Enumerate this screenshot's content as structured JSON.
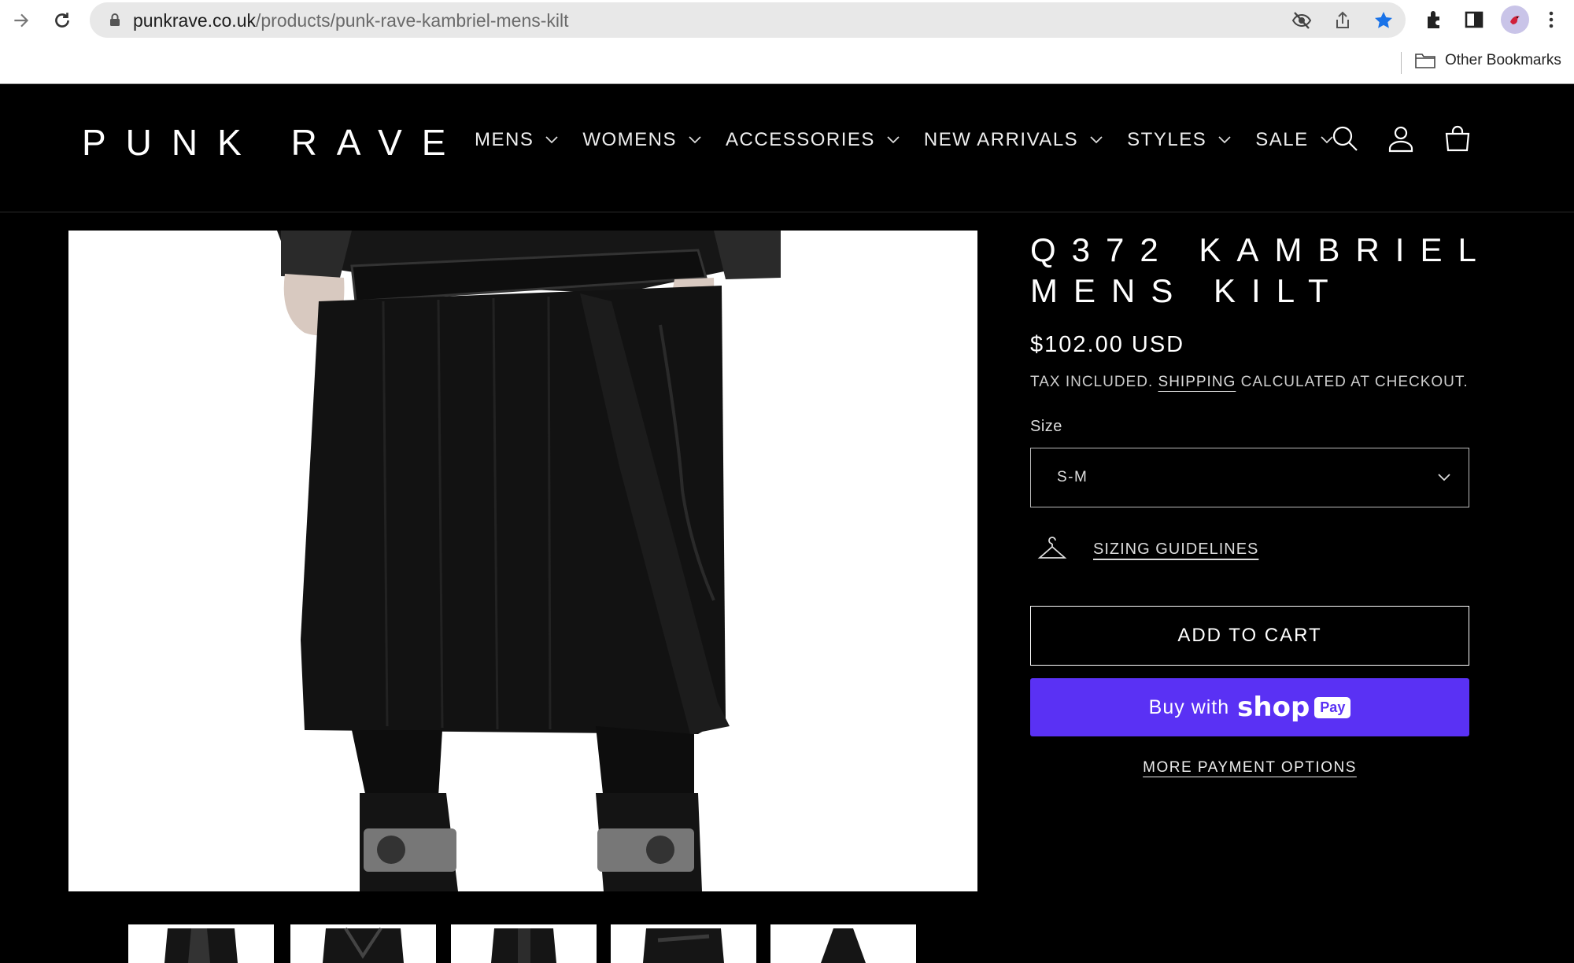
{
  "browser": {
    "url_host": "punkrave.co.uk",
    "url_path": "/products/punk-rave-kambriel-mens-kilt",
    "bookmarks_label": "Other Bookmarks",
    "star_color": "#1a73e8"
  },
  "site": {
    "logo": "PUNK RAVE",
    "nav": [
      {
        "label": "MENS"
      },
      {
        "label": "WOMENS"
      },
      {
        "label": "ACCESSORIES"
      },
      {
        "label": "NEW ARRIVALS"
      },
      {
        "label": "STYLES"
      },
      {
        "label": "SALE"
      }
    ],
    "header_icons": [
      "search-icon",
      "account-icon",
      "cart-icon"
    ]
  },
  "product": {
    "title": "Q372 KAMBRIEL MENS KILT",
    "price": "$102.00 USD",
    "tax_prefix": "TAX INCLUDED.",
    "tax_link": "SHIPPING",
    "tax_suffix": "CALCULATED AT CHECKOUT.",
    "size_label": "Size",
    "size_selected": "S-M",
    "sizing_guidelines": "SIZING GUIDELINES",
    "add_to_cart": "ADD TO CART",
    "buy_with": "Buy with",
    "shop_word": "shop",
    "pay_word": "Pay",
    "more_payment": "MORE PAYMENT OPTIONS",
    "shop_pay_color": "#5a31f4",
    "thumbnail_count": 5
  }
}
